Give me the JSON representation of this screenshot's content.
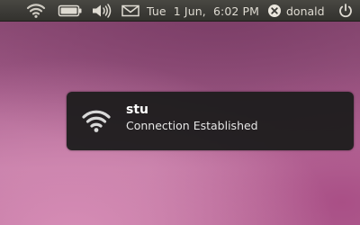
{
  "panel": {
    "icons": {
      "network": "wifi-signal-icon",
      "battery": "battery-icon",
      "volume": "volume-icon",
      "messaging": "envelope-icon",
      "user_status": "user-offline-icon",
      "session": "power-icon"
    },
    "clock": "Tue  1 Jun,  6:02 PM",
    "username": "donald",
    "battery_level": 1.0
  },
  "notification": {
    "icon": "wifi-signal-icon",
    "title": "stu",
    "body": "Connection Established"
  },
  "colors": {
    "panel_background": "#3c3b37",
    "panel_text": "#dfdbd2",
    "notification_background": "#1c1c1c",
    "wallpaper": "#a45d8a"
  }
}
